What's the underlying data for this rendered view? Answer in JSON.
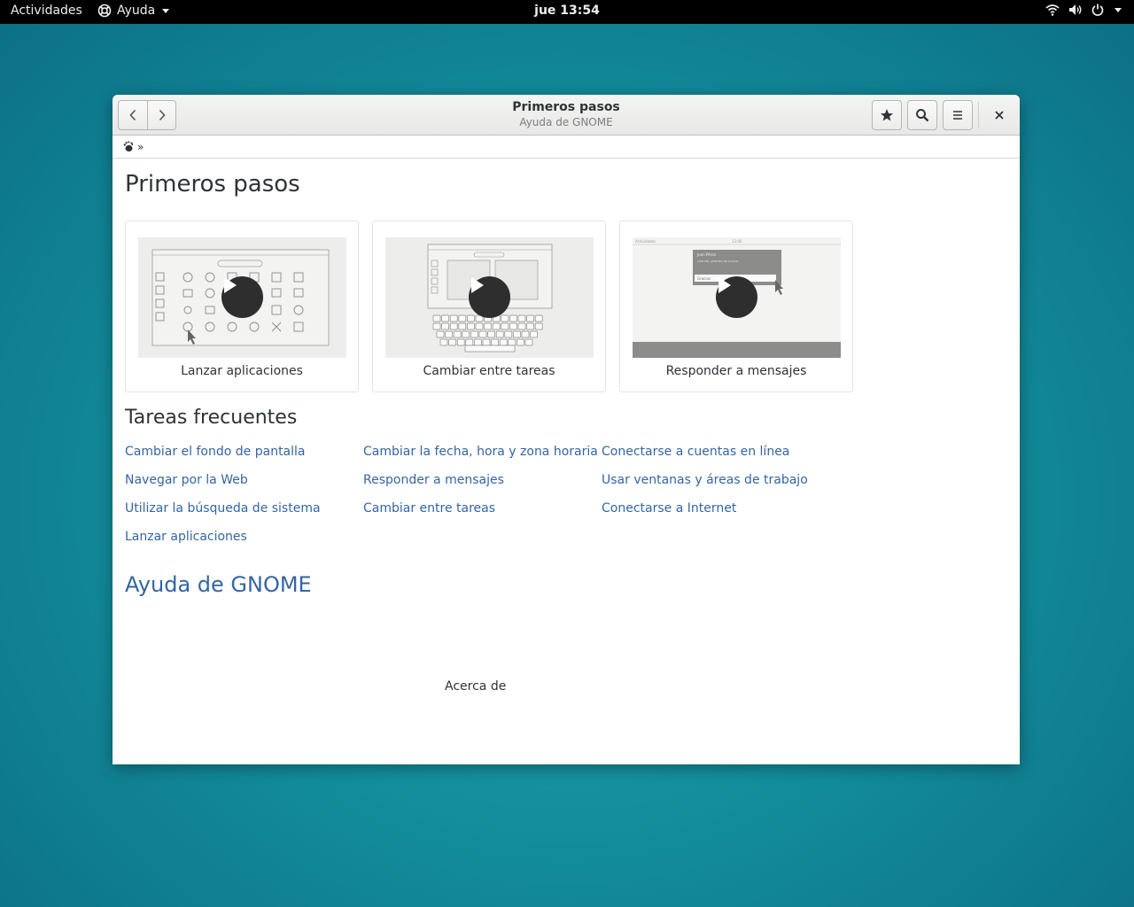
{
  "topbar": {
    "activities": "Actividades",
    "app_menu": "Ayuda",
    "clock": "jue 13:54",
    "icons": [
      "wifi-icon",
      "volume-icon",
      "power-icon"
    ]
  },
  "window": {
    "title": "Primeros pasos",
    "subtitle": "Ayuda de GNOME",
    "breadcrumb_sep": "»",
    "page_title": "Primeros pasos",
    "cards": [
      {
        "caption": "Lanzar aplicaciones"
      },
      {
        "caption": "Cambiar entre tareas"
      },
      {
        "caption": "Responder a mensajes"
      }
    ],
    "thumb_text": {
      "activities": "Actividades",
      "time": "13:00",
      "user": "Juan Pérez",
      "message": "¡Genial, gracias de nuevo.",
      "reply": "Gracias"
    },
    "section_title": "Tareas frecuentes",
    "tasks": [
      "Cambiar el fondo de pantalla",
      "Cambiar la fecha, hora y zona horaria",
      "Conectarse a cuentas en línea",
      "Navegar por la Web",
      "Responder a mensajes",
      "Usar ventanas y áreas de trabajo",
      "Utilizar la búsqueda de sistema",
      "Cambiar entre tareas",
      "Conectarse a Internet",
      "Lanzar aplicaciones"
    ],
    "gnome_help": "Ayuda de GNOME",
    "about": "Acerca de"
  },
  "colors": {
    "link": "#3465a4",
    "topbar": "#000000",
    "text": "#2e3436"
  }
}
